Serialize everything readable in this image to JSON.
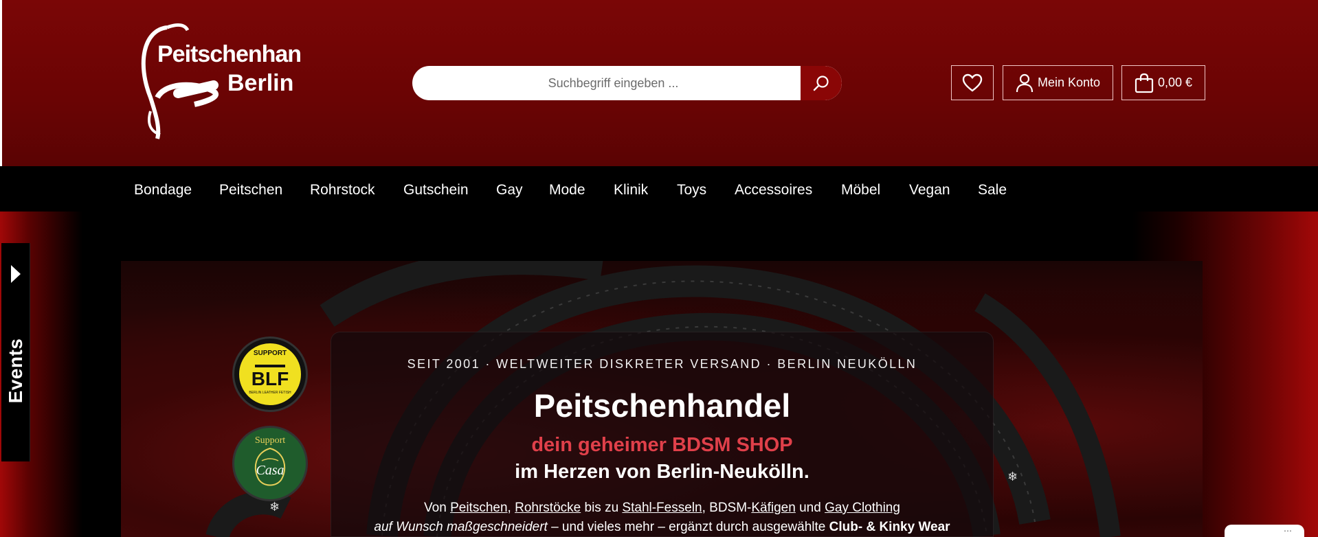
{
  "header": {
    "logo": {
      "line1": "Peitschenhandel",
      "line2": "Berlin"
    },
    "search": {
      "placeholder": "Suchbegriff eingeben ..."
    },
    "buttons": {
      "wishlist_icon": "heart-icon",
      "account_label": "Mein Konto",
      "account_icon": "user-icon",
      "cart_total": "0,00 €",
      "cart_icon": "shopping-bag-icon"
    }
  },
  "nav": {
    "items": [
      "Bondage",
      "Peitschen",
      "Rohrstock",
      "Gutschein",
      "Gay",
      "Mode",
      "Klinik",
      "Toys",
      "Accessoires",
      "Möbel",
      "Vegan",
      "Sale"
    ]
  },
  "side_tab": {
    "label": "Events"
  },
  "hero": {
    "tagline": "SEIT 2001 · WELTWEITER DISKRETER VERSAND · BERLIN NEUKÖLLN",
    "title": "Peitschenhandel",
    "subtitle": "dein geheimer BDSM SHOP",
    "subtitle2": "im Herzen von Berlin-Neukölln.",
    "text_prefix": "Von ",
    "link1": "Peitschen",
    "sep1": ", ",
    "link2": "Rohrstöcke",
    "text_mid1": " bis zu ",
    "link3": "Stahl-Fesseln",
    "text_mid2": ", BDSM-",
    "link4": "Käfigen",
    "text_mid3": " und ",
    "link5": "Gay Clothing",
    "line2_italic": "auf Wunsch maßgeschneidert",
    "line2_text": " – und vieles mehr – ergänzt durch ausgewählte ",
    "line2_bold": "Club- & Kinky Wear",
    "badges": {
      "blf": {
        "top": "SUPPORT",
        "main": "BLF",
        "bottom": "BERLIN LEATHER FETISH"
      },
      "casa": {
        "top": "Support",
        "main": "Casa"
      }
    }
  },
  "colors": {
    "header_bg": "#6a0404",
    "accent_red": "#e0404a",
    "search_btn": "#8a0606"
  }
}
